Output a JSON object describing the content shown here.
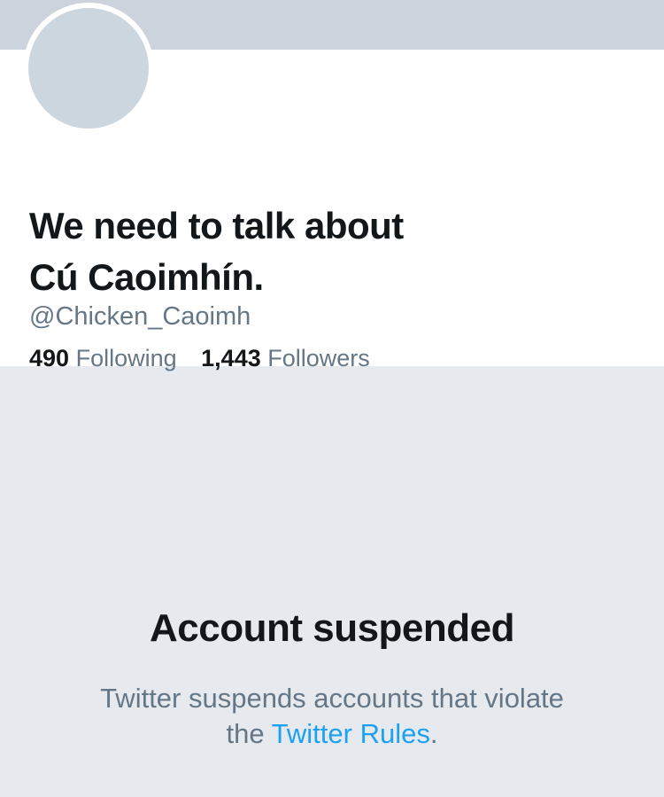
{
  "profile": {
    "display_name_line1": "We need to talk about",
    "display_name_line2": "Cú Caoimhín.",
    "handle": "@Chicken_Caoimh",
    "following_count": "490",
    "following_label": "Following",
    "followers_count": "1,443",
    "followers_label": "Followers"
  },
  "suspension": {
    "title": "Account suspended",
    "message_line1": "Twitter suspends accounts that violate",
    "message_prefix": "the ",
    "rules_link": "Twitter Rules",
    "message_suffix": "."
  },
  "colors": {
    "banner": "#ccd3dc",
    "avatar": "#ccd6df",
    "background": "#e6e9ee",
    "text_primary": "#14171a",
    "text_secondary": "#657786",
    "link": "#1da1f2"
  }
}
